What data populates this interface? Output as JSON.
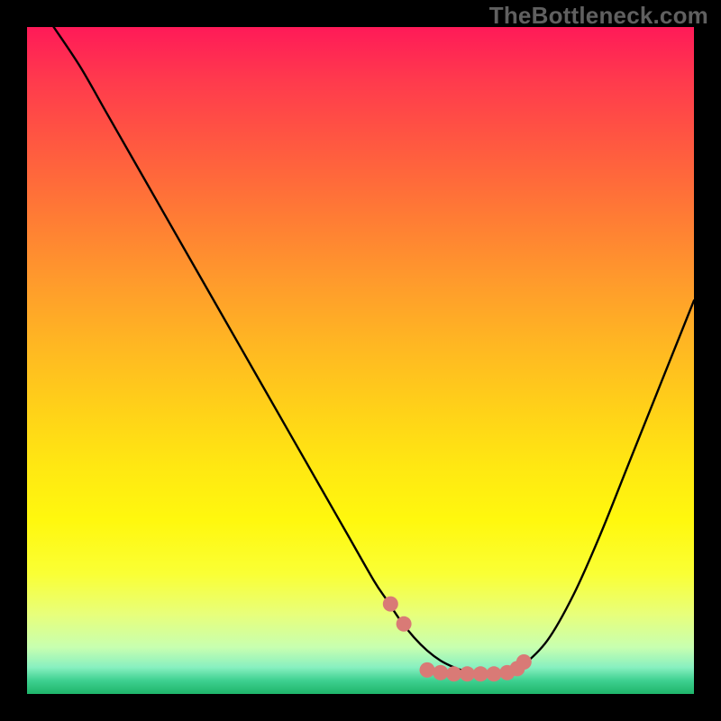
{
  "watermark": "TheBottleneck.com",
  "colors": {
    "background": "#000000",
    "curve": "#000000",
    "marker_fill": "#d97a76",
    "marker_stroke": "#c96560"
  },
  "chart_data": {
    "type": "line",
    "title": "",
    "xlabel": "",
    "ylabel": "",
    "x_range": [
      0,
      100
    ],
    "y_range": [
      0,
      100
    ],
    "series": [
      {
        "name": "curve",
        "x": [
          4,
          8,
          12,
          16,
          20,
          24,
          28,
          32,
          36,
          40,
          44,
          48,
          52,
          54,
          56,
          58,
          60,
          62,
          64,
          66,
          68,
          70,
          72,
          74,
          78,
          82,
          86,
          90,
          94,
          98,
          100
        ],
        "y": [
          100,
          94,
          87,
          80,
          73,
          66,
          59,
          52,
          45,
          38,
          31,
          24,
          17,
          14,
          11,
          8.5,
          6.5,
          5,
          4,
          3.3,
          3,
          3,
          3.2,
          4,
          8,
          15,
          24,
          34,
          44,
          54,
          59
        ]
      }
    ],
    "markers": {
      "name": "highlight-dots",
      "x": [
        54.5,
        56.5,
        60,
        62,
        64,
        66,
        68,
        70,
        72,
        73.5,
        74.5
      ],
      "y": [
        13.5,
        10.5,
        3.6,
        3.2,
        3.0,
        3.0,
        3.0,
        3.0,
        3.2,
        3.8,
        4.8
      ]
    }
  }
}
